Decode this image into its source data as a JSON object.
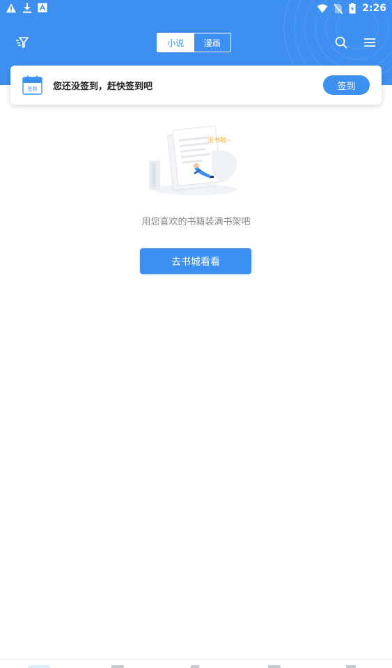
{
  "status_bar": {
    "time": "2:26",
    "left_icons": [
      "warning-icon",
      "download-icon",
      "font-icon"
    ],
    "right_icons": [
      "wifi-icon",
      "no-sim-icon",
      "battery-icon"
    ]
  },
  "topbar": {
    "tabs": [
      {
        "label": "小说",
        "active": true
      },
      {
        "label": "漫画",
        "active": false
      }
    ],
    "icons": [
      "filter-icon",
      "search-icon",
      "menu-icon"
    ]
  },
  "checkin": {
    "icon_label": "签到",
    "message": "您还没签到，赶快签到吧",
    "button_label": "签到"
  },
  "empty_state": {
    "illustration_text": "没书啦~",
    "message": "用您喜欢的书籍装满书架吧",
    "button_label": "去书城看看"
  },
  "colors": {
    "accent": "#3d8ff0",
    "illustration_orange": "#f5a623"
  }
}
